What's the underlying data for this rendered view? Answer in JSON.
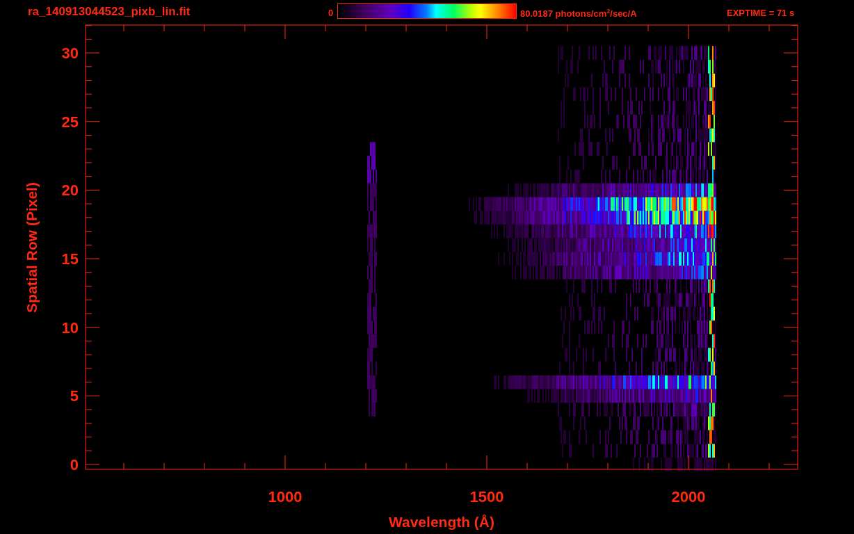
{
  "header": {
    "filename": "ra_140913044523_pixb_lin.fit",
    "colorbar": {
      "min_label": "0",
      "max_label": "80.0187 photons/cm$^{2}$/sec/A"
    },
    "exposure": "EXPTIME = 71 s"
  },
  "plot": {
    "xlabel": "Wavelength (Å)",
    "ylabel": "Spatial Row (Pixel)",
    "x_tick_labels": [
      "1000",
      "1500",
      "2000"
    ],
    "y_tick_labels": [
      "30",
      "25",
      "20",
      "15",
      "10",
      "5",
      "0"
    ]
  }
}
